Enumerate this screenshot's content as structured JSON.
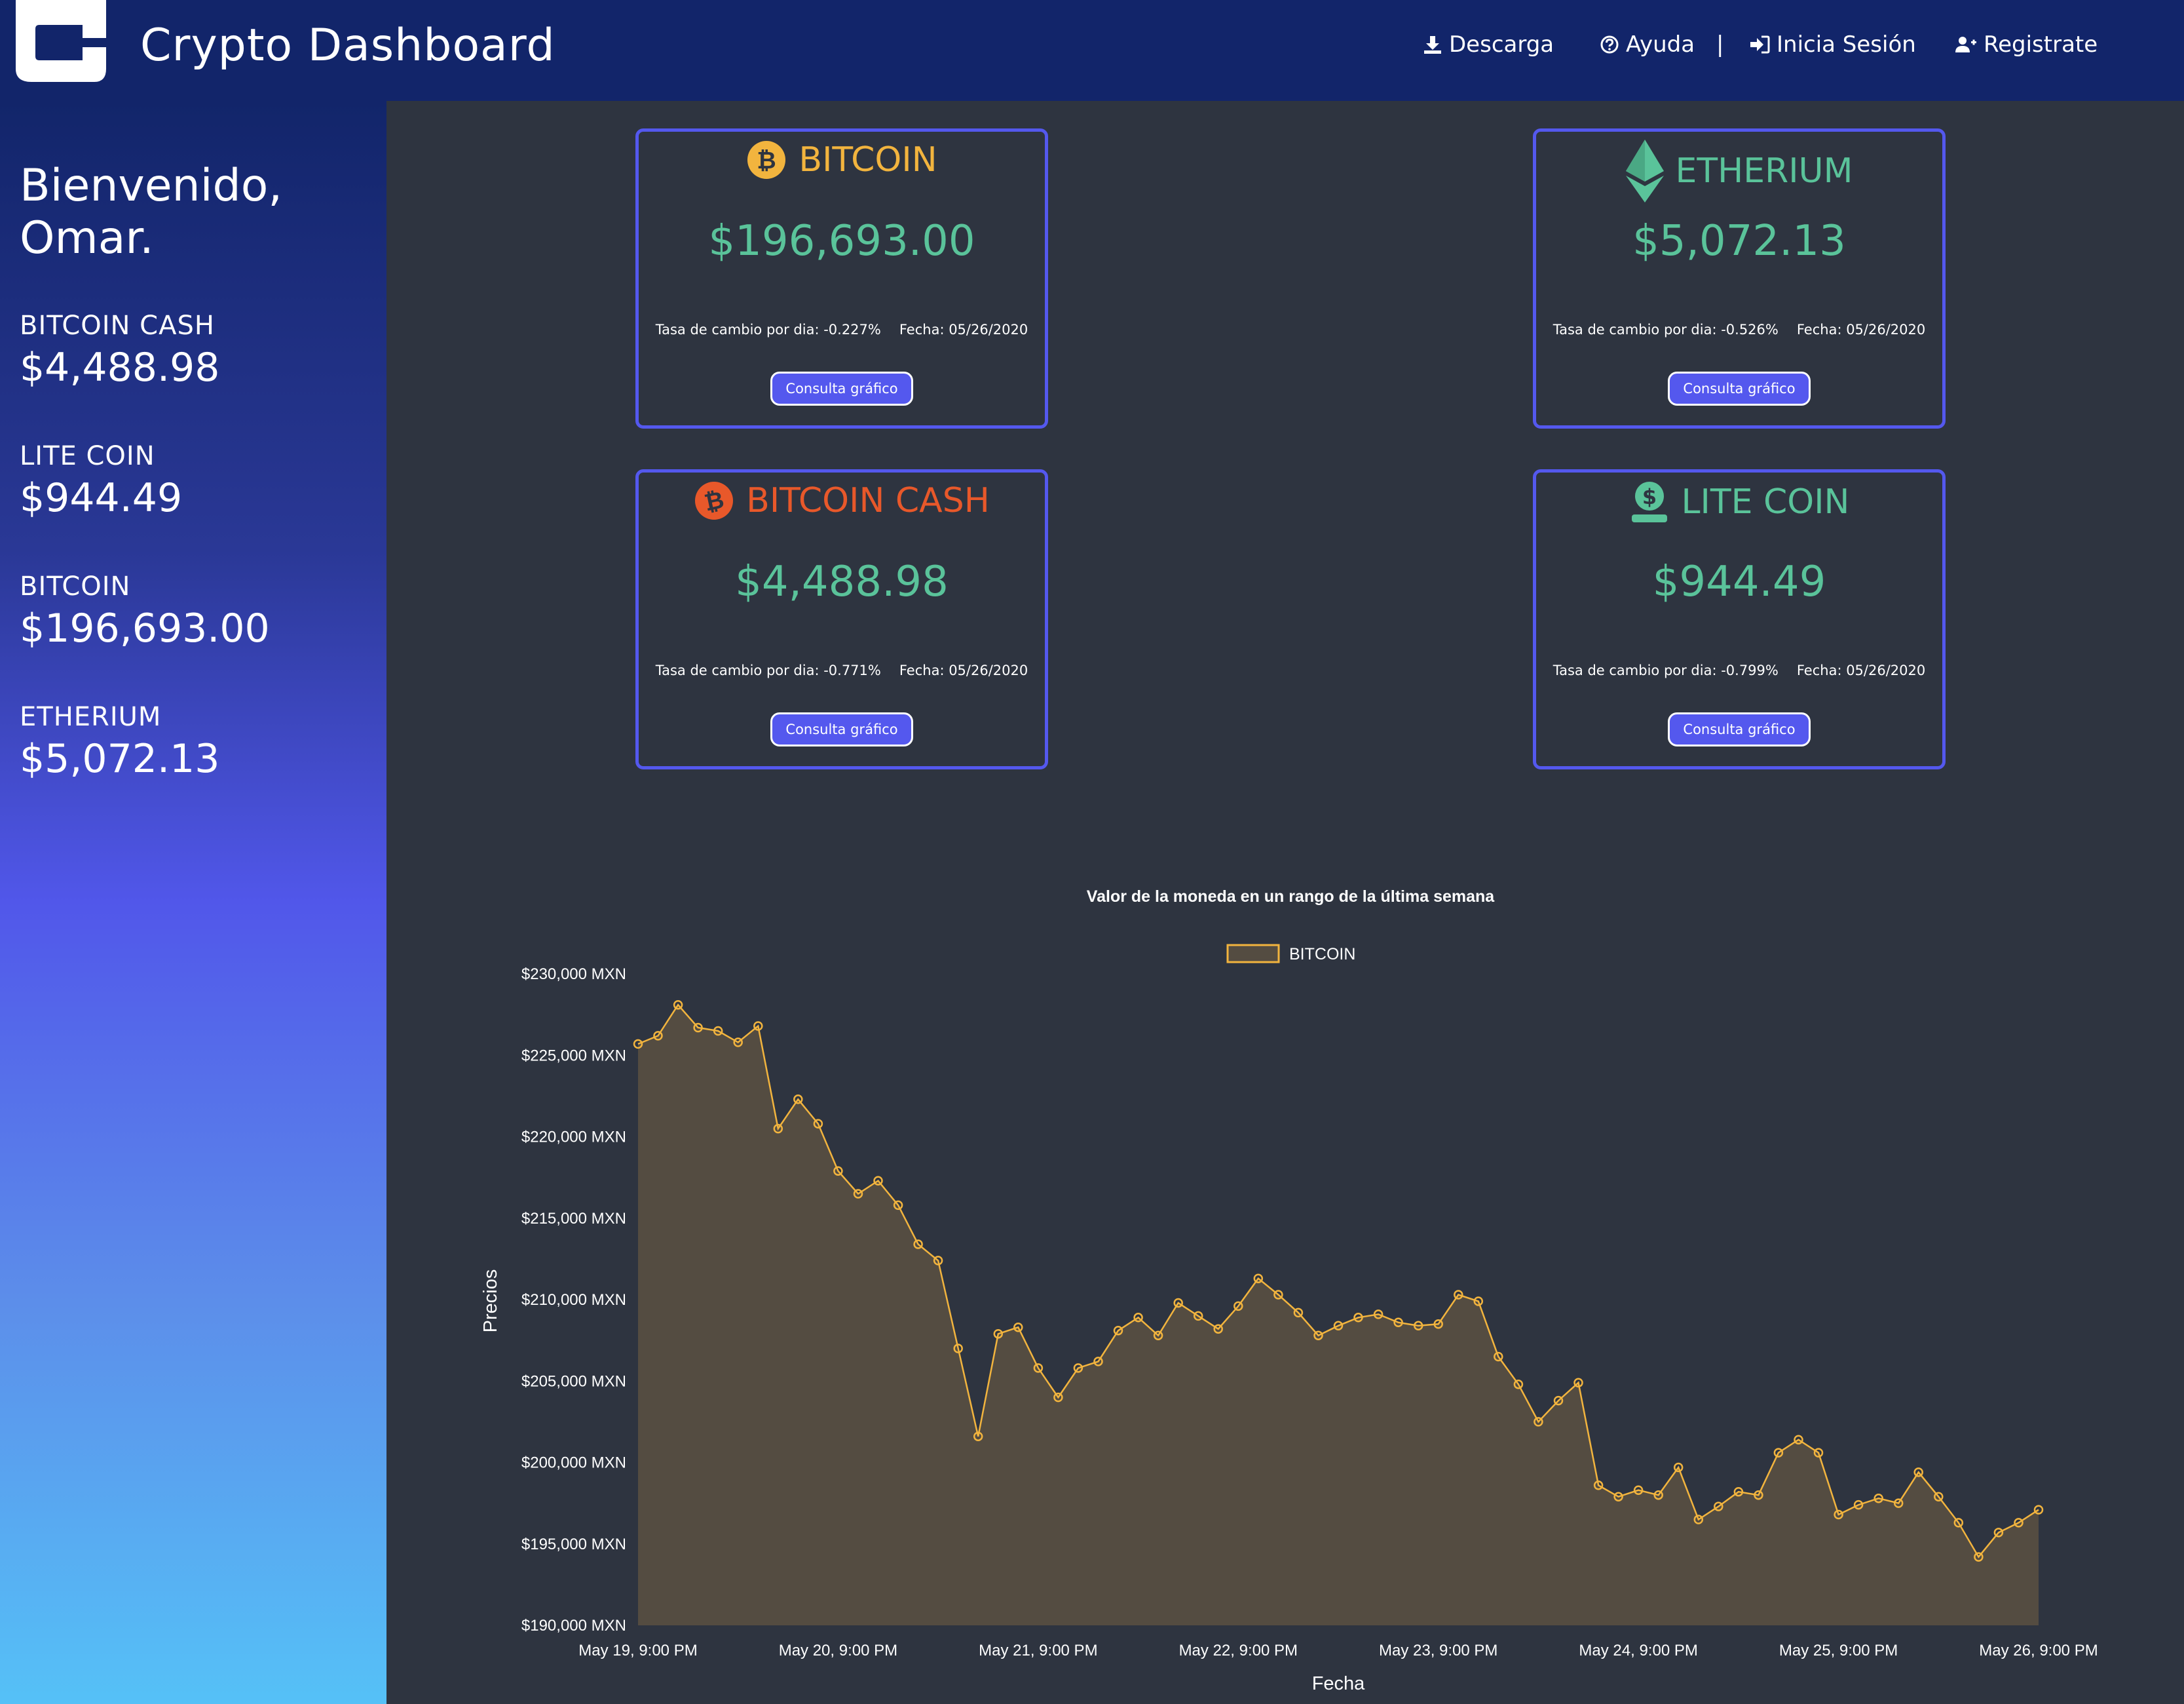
{
  "header": {
    "title": "Crypto Dashboard",
    "nav": {
      "download": "Descarga",
      "help": "Ayuda",
      "separator": "|",
      "login": "Inicia Sesión",
      "register": "Registrate"
    }
  },
  "sidebar": {
    "welcome": "Bienvenido, Omar.",
    "coins": [
      {
        "name": "BITCOIN CASH",
        "price": "$4,488.98"
      },
      {
        "name": "LITE COIN",
        "price": "$944.49"
      },
      {
        "name": "BITCOIN",
        "price": "$196,693.00"
      },
      {
        "name": "ETHERIUM",
        "price": "$5,072.13"
      }
    ]
  },
  "cards": [
    {
      "name": "BITCOIN",
      "icon": "bitcoin-icon",
      "color": "#f2b43e",
      "price": "$196,693.00",
      "rate": "Tasa de cambio por dia: -0.227%",
      "date": "Fecha: 05/26/2020",
      "button": "Consulta gráfico"
    },
    {
      "name": "ETHERIUM",
      "icon": "ethereum-icon",
      "color": "#5ac39a",
      "price": "$5,072.13",
      "rate": "Tasa de cambio por dia: -0.526%",
      "date": "Fecha: 05/26/2020",
      "button": "Consulta gráfico"
    },
    {
      "name": "BITCOIN CASH",
      "icon": "bitcoin-cash-icon",
      "color": "#e8582a",
      "price": "$4,488.98",
      "rate": "Tasa de cambio por dia: -0.771%",
      "date": "Fecha: 05/26/2020",
      "button": "Consulta gráfico"
    },
    {
      "name": "LITE COIN",
      "icon": "dollar-hand-icon",
      "color": "#5ac39a",
      "price": "$944.49",
      "rate": "Tasa de cambio por dia: -0.799%",
      "date": "Fecha: 05/26/2020",
      "button": "Consulta gráfico"
    }
  ],
  "colors": {
    "header": "#12256a",
    "accent": "#5458ee",
    "price": "#5ac39a",
    "line": "#f2b43e",
    "fill": "#544c41",
    "panel": "#2e3440"
  },
  "chart_data": {
    "type": "area",
    "title": "Valor de la moneda en un rango de la última semana",
    "xlabel": "Fecha",
    "ylabel": "Precios",
    "legend": [
      "BITCOIN"
    ],
    "legend_position": "top-center",
    "ylim": [
      190000,
      230000
    ],
    "yticks": [
      "$230,000 MXN",
      "$225,000 MXN",
      "$220,000 MXN",
      "$215,000 MXN",
      "$210,000 MXN",
      "$205,000 MXN",
      "$200,000 MXN",
      "$195,000 MXN",
      "$190,000 MXN"
    ],
    "xticks": [
      "May 19, 9:00 PM",
      "May 20, 9:00 PM",
      "May 21, 9:00 PM",
      "May 22, 9:00 PM",
      "May 23, 9:00 PM",
      "May 24, 9:00 PM",
      "May 25, 9:00 PM",
      "May 26, 9:00 PM"
    ],
    "x_days": [
      0,
      0.1,
      0.2,
      0.3,
      0.4,
      0.5,
      0.6,
      0.7,
      0.8,
      0.9,
      1.0,
      1.1,
      1.2,
      1.3,
      1.4,
      1.5,
      1.6,
      1.7,
      1.8,
      1.9,
      2.0,
      2.1,
      2.2,
      2.3,
      2.4,
      2.5,
      2.6,
      2.7,
      2.8,
      2.9,
      3.0,
      3.1,
      3.2,
      3.3,
      3.4,
      3.5,
      3.6,
      3.7,
      3.8,
      3.9,
      4.0,
      4.1,
      4.2,
      4.3,
      4.4,
      4.5,
      4.6,
      4.7,
      4.8,
      4.9,
      5.0,
      5.1,
      5.2,
      5.3,
      5.4,
      5.5,
      5.6,
      5.7,
      5.8,
      5.9,
      6.0,
      6.1,
      6.2,
      6.3,
      6.4,
      6.5,
      6.6,
      6.7,
      6.8,
      6.9,
      7.0
    ],
    "series": [
      {
        "name": "BITCOIN",
        "values": [
          225700,
          226200,
          228100,
          226700,
          226500,
          225800,
          226800,
          220500,
          222300,
          220800,
          217900,
          216500,
          217300,
          215800,
          213400,
          212400,
          207000,
          201600,
          207900,
          208300,
          205800,
          204000,
          205800,
          206200,
          208100,
          208900,
          207800,
          209800,
          209000,
          208200,
          209600,
          211300,
          210300,
          209200,
          207800,
          208400,
          208900,
          209100,
          208600,
          208400,
          208500,
          210300,
          209900,
          206500,
          204800,
          202500,
          203800,
          204900,
          198600,
          197900,
          198300,
          198000,
          199700,
          196500,
          197300,
          198200,
          198000,
          200600,
          201400,
          200600,
          196800,
          197400,
          197800,
          197500,
          199400,
          197900,
          196300,
          194200,
          195700,
          196300,
          197100
        ]
      }
    ]
  }
}
